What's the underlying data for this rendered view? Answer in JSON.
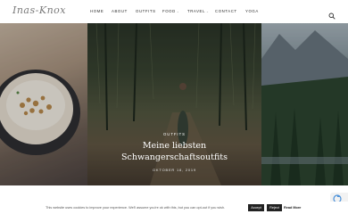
{
  "header": {
    "logo_text": "Inas-Knox",
    "nav": [
      "HOME",
      "ABOUT",
      "OUTFITS",
      "FOOD",
      "TRAVEL",
      "CONTACT",
      "YOGA"
    ],
    "nav_has_dropdown": [
      false,
      false,
      false,
      true,
      true,
      false,
      false
    ],
    "search_icon": "search-icon"
  },
  "hero": {
    "category": "OUTFITS",
    "title_line1": "Meine liebsten",
    "title_line2": "Schwangerschaftsoutfits",
    "date": "OKTOBER 18, 2019"
  },
  "cookie": {
    "text": "This website uses cookies to improve your experience. We'll assume you're ok with this, but you can opt-out if you wish.",
    "accept_label": "Accept",
    "reject_label": "Reject",
    "read_more_label": "Read More"
  },
  "colors": {
    "nav_text": "#2b2b2b",
    "button_bg": "#222222",
    "accent": "#ffffff"
  }
}
